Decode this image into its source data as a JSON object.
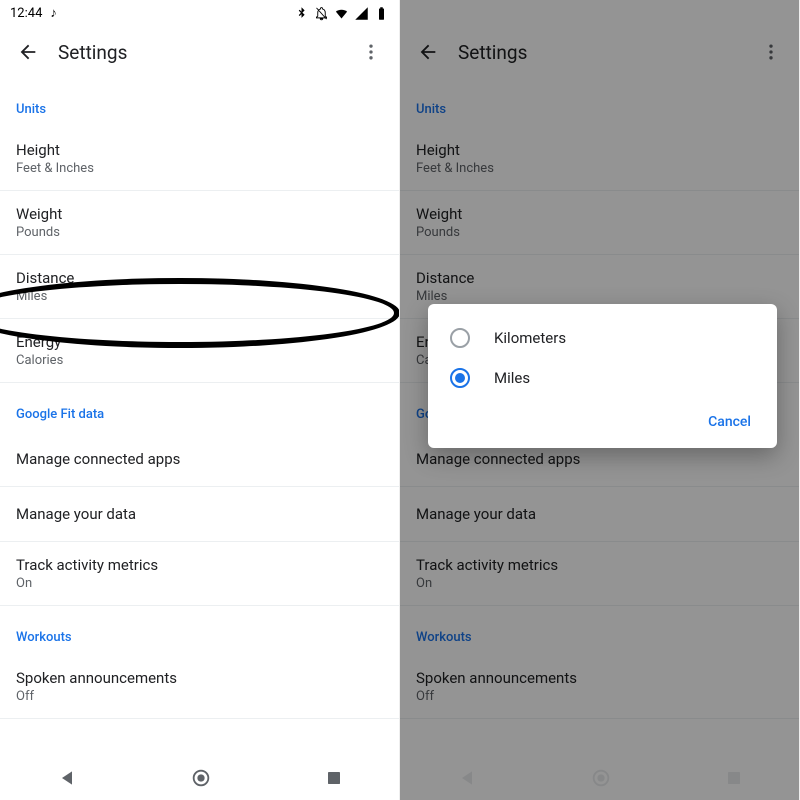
{
  "status": {
    "time": "12:44",
    "music_icon": "♪"
  },
  "appbar": {
    "title": "Settings"
  },
  "sections": {
    "units": {
      "header": "Units",
      "height": {
        "title": "Height",
        "sub": "Feet & Inches"
      },
      "weight": {
        "title": "Weight",
        "sub": "Pounds"
      },
      "distance": {
        "title": "Distance",
        "sub": "Miles"
      },
      "energy": {
        "title": "Energy",
        "sub": "Calories"
      }
    },
    "fit": {
      "header": "Google Fit data",
      "apps": {
        "title": "Manage connected apps"
      },
      "data": {
        "title": "Manage your data"
      },
      "track": {
        "title": "Track activity metrics",
        "sub": "On"
      }
    },
    "workouts": {
      "header": "Workouts",
      "spoken": {
        "title": "Spoken announcements",
        "sub": "Off"
      }
    }
  },
  "dialog": {
    "option1": "Kilometers",
    "option2": "Miles",
    "cancel": "Cancel"
  }
}
